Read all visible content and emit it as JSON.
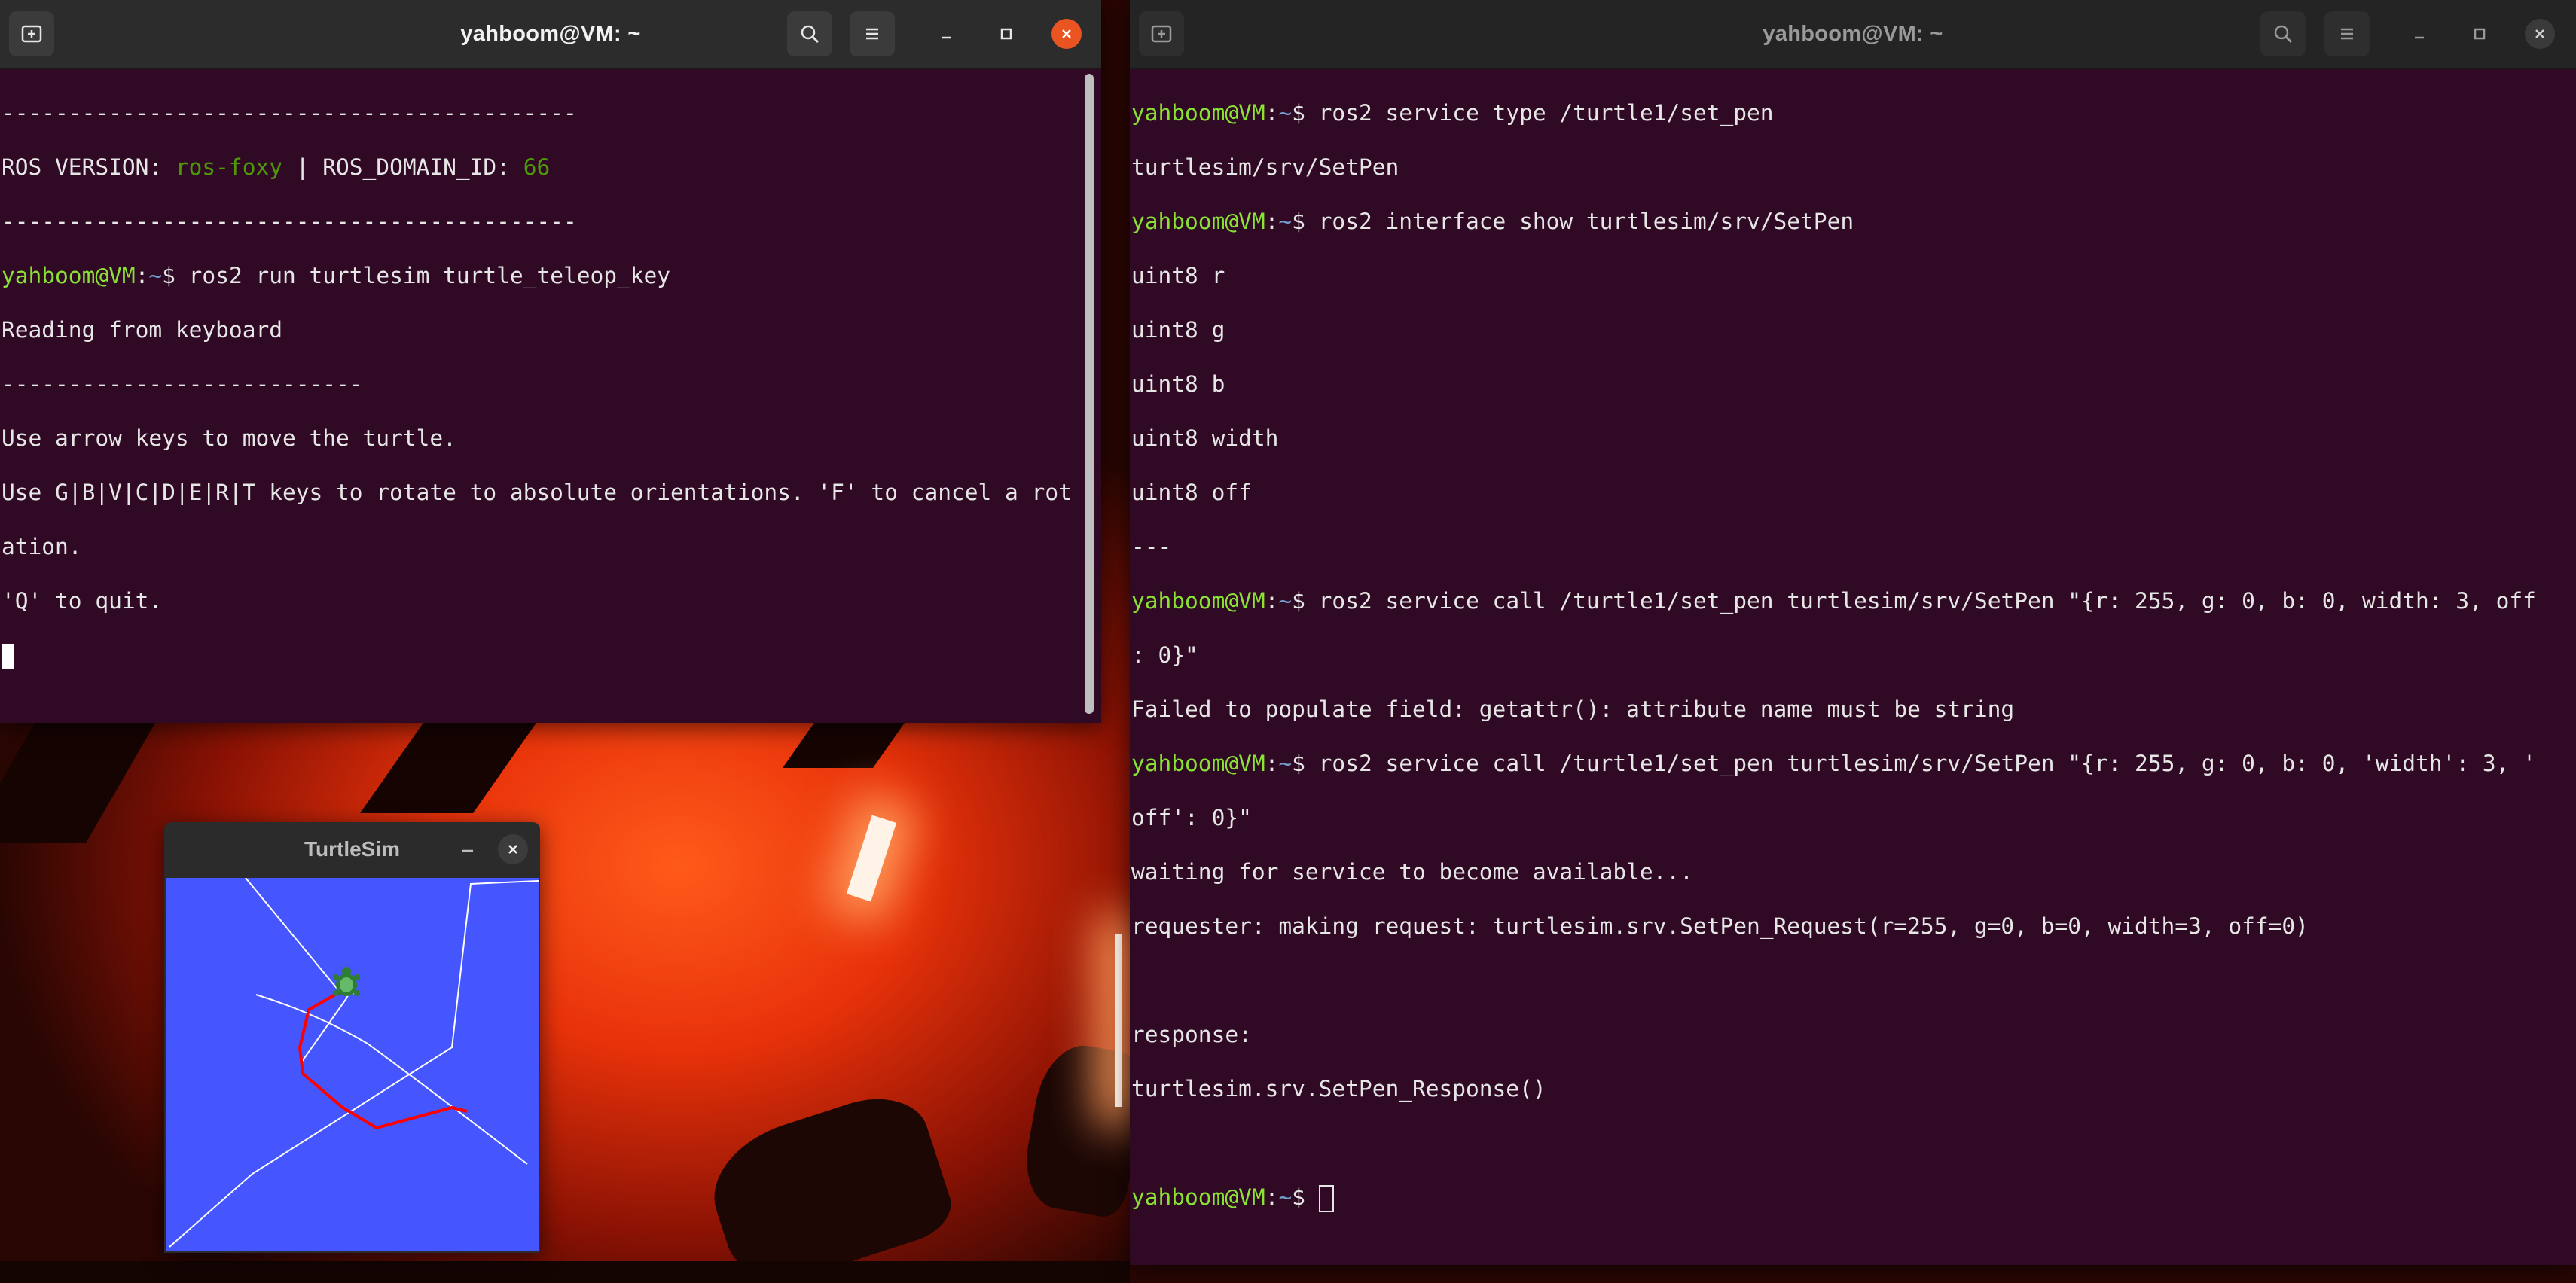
{
  "colors": {
    "terminal_bg": "#300a24",
    "prompt_user": "#8ae234",
    "prompt_path": "#729fcf",
    "ros_value": "#4e9a06",
    "text": "#e6e6e6",
    "close_active": "#e95420",
    "turtle_bg": "#4556ff",
    "trail_white": "#ffffff",
    "trail_red": "#ff0000"
  },
  "left_terminal": {
    "title": "yahboom@VM: ~",
    "new_tab_icon": "new-tab-icon",
    "search_icon": "search-icon",
    "menu_icon": "hamburger-menu-icon",
    "lines": {
      "sep1": "-------------------------------------------",
      "ros_label": "ROS VERSION: ",
      "ros_version": "ros-foxy",
      "ros_mid": " | ROS_DOMAIN_ID: ",
      "ros_domain": "66",
      "sep2": "-------------------------------------------",
      "prompt_user": "yahboom@VM",
      "prompt_colon": ":",
      "prompt_path": "~",
      "prompt_dollar": "$ ",
      "cmd1": "ros2 run turtlesim turtle_teleop_key",
      "out1": "Reading from keyboard",
      "sep3": "---------------------------",
      "out2": "Use arrow keys to move the turtle.",
      "out3": "Use G|B|V|C|D|E|R|T keys to rotate to absolute orientations. 'F' to cancel a rot",
      "out4": "ation.",
      "out5": "'Q' to quit."
    }
  },
  "right_terminal": {
    "title": "yahboom@VM: ~",
    "prompt_user": "yahboom@VM",
    "prompt_colon": ":",
    "prompt_path": "~",
    "prompt_dollar": "$ ",
    "lines": {
      "cmd1": "ros2 service type /turtle1/set_pen",
      "out1": "turtlesim/srv/SetPen",
      "cmd2": "ros2 interface show turtlesim/srv/SetPen",
      "out2": "uint8 r",
      "out3": "uint8 g",
      "out4": "uint8 b",
      "out5": "uint8 width",
      "out6": "uint8 off",
      "out7": "---",
      "cmd3": "ros2 service call /turtle1/set_pen turtlesim/srv/SetPen \"{r: 255, g: 0, b: 0, width: 3, off",
      "cmd3b": ": 0}\"",
      "out8": "Failed to populate field: getattr(): attribute name must be string",
      "cmd4": "ros2 service call /turtle1/set_pen turtlesim/srv/SetPen \"{r: 255, g: 0, b: 0, 'width': 3, '",
      "cmd4b": "off': 0}\"",
      "out9": "waiting for service to become available...",
      "out10": "requester: making request: turtlesim.srv.SetPen_Request(r=255, g=0, b=0, width=3, off=0)",
      "out11": "",
      "out12": "response:",
      "out13": "turtlesim.srv.SetPen_Response()",
      "out14": ""
    }
  },
  "turtlesim": {
    "title": "TurtleSim",
    "minimize_icon": "minimize-icon",
    "close_icon": "close-icon",
    "turtle_icon": "turtle-icon"
  }
}
